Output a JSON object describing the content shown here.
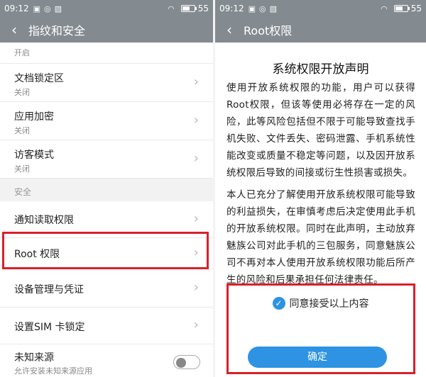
{
  "left": {
    "status": {
      "time": "09:12",
      "battery": "55"
    },
    "header": {
      "back_icon": "‹",
      "title": "指纹和安全"
    },
    "partial_item_sub": "开启",
    "items": [
      {
        "label": "文档锁定区",
        "sub": "关闭"
      },
      {
        "label": "应用加密",
        "sub": "关闭"
      },
      {
        "label": "访客模式",
        "sub": "关闭"
      }
    ],
    "section": "安全",
    "items2": [
      {
        "label": "通知读取权限"
      },
      {
        "label": "Root 权限"
      },
      {
        "label": "设备管理与凭证"
      },
      {
        "label": "设置SIM 卡锁定"
      }
    ],
    "unknown_sources": {
      "label": "未知来源",
      "sub": "允许安装未知来源应用",
      "enabled": false
    }
  },
  "right": {
    "status": {
      "time": "09:12",
      "battery": "55"
    },
    "header": {
      "back_icon": "‹",
      "title": "Root权限"
    },
    "declaration_title": "系统权限开放声明",
    "paragraph1": "使用开放系统权限的功能，用户可以获得Root权限，但该等使用必将存在一定的风险，此等风险包括但不限于可能导致查找手机失败、文件丢失、密码泄露、手机系统性能改变或质量不稳定等问题，以及因开放系统权限后导致的间接或衍生性损害或损失。",
    "paragraph2": "本人已充分了解使用开放系统权限可能导致的利益损失，在审慎考虑后决定使用此手机的开放系统权限。同时在此声明，主动放弃魅族公司对此手机的三包服务，同意魅族公司不再对本人使用开放系统权限功能后所产生的风险和后果承担任何法律责任。",
    "agree_label": "同意接受以上内容",
    "agree_checked": true,
    "confirm_label": "确定"
  },
  "colors": {
    "accent": "#2d93e2",
    "header": "#848b90",
    "highlight": "#d9202a"
  }
}
